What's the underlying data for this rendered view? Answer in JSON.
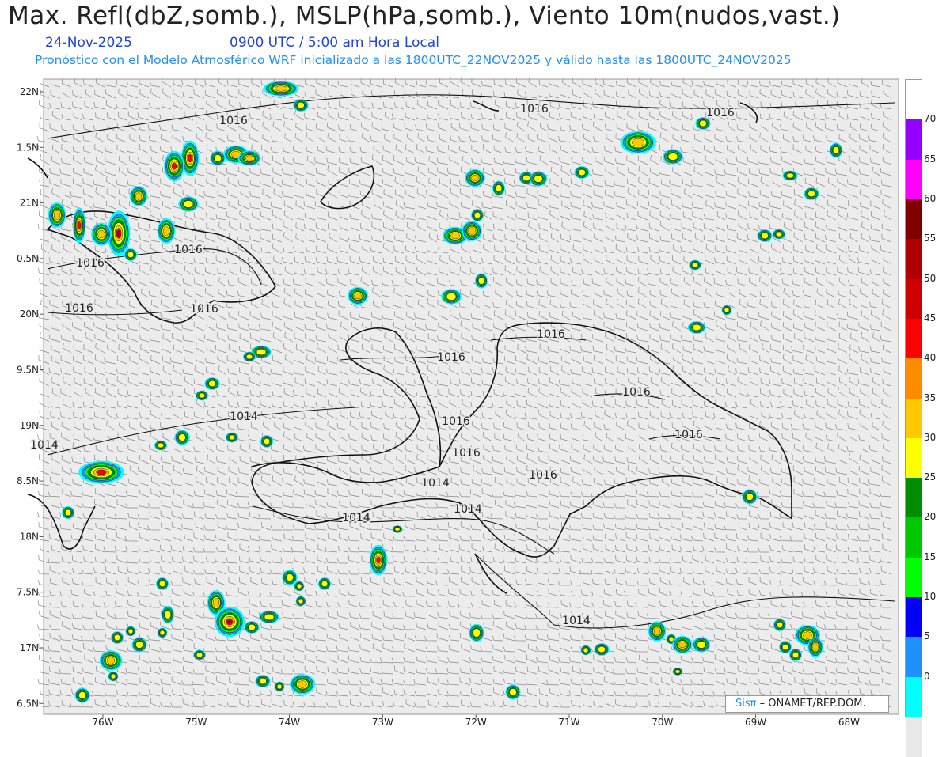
{
  "title": "Max. Refl(dbZ,somb.), MSLP(hPa,somb.), Viento 10m(nudos,vast.)",
  "date": "24-Nov-2025",
  "time": "0900 UTC / 5:00 am Hora Local",
  "description": "Pronóstico con el Modelo Atmosférico WRF inicializado a las 1800UTC_22NOV2025 y válido hasta las  1800UTC_24NOV2025",
  "credit": {
    "logo": "Sisπ",
    "org": "– ONAMET/REP.DOM."
  },
  "colors": {
    "background": "#ececec",
    "barb": "#888888",
    "coast": "#111111",
    "contour": "#111111"
  },
  "lat_labels": [
    "22N",
    "1.5N",
    "21N",
    "0.5N",
    "20N",
    "9.5N",
    "19N",
    "8.5N",
    "18N",
    "7.5N",
    "17N",
    "6.5N"
  ],
  "lon_labels": [
    "76W",
    "75W",
    "74W",
    "73W",
    "72W",
    "71W",
    "70W",
    "69W",
    "68W"
  ],
  "isobar_labels": [
    "1016",
    "1016",
    "1016",
    "1016",
    "1016",
    "1016",
    "1016",
    "1016",
    "1016",
    "1016",
    "1016",
    "1016",
    "1016",
    "1016",
    "1014",
    "1014",
    "1014",
    "1014",
    "1014",
    "1014"
  ],
  "colorbar": {
    "labels": [
      "70",
      "65",
      "60",
      "55",
      "50",
      "45",
      "40",
      "35",
      "30",
      "25",
      "20",
      "15",
      "10",
      "5",
      "0"
    ],
    "colors": [
      "#e8e8e8",
      "#00ffff",
      "#1e90ff",
      "#0000ff",
      "#00ff00",
      "#00c800",
      "#008c00",
      "#ffff00",
      "#ffc800",
      "#ff8c00",
      "#ff0000",
      "#d00000",
      "#b00000",
      "#800000",
      "#ff00ff",
      "#9400ff",
      "#ffffff"
    ]
  }
}
